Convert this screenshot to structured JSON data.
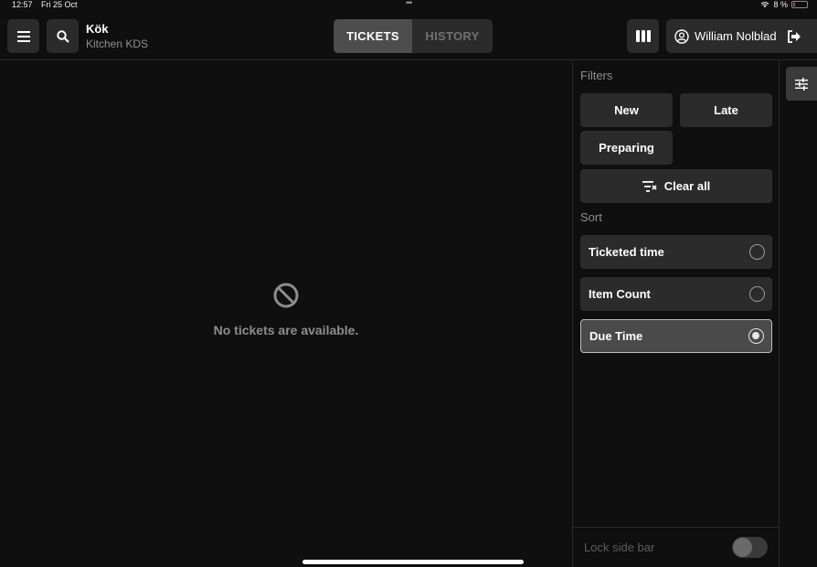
{
  "status": {
    "time": "12:57",
    "date": "Fri 25 Oct",
    "dots": "•••",
    "battery": "8 %"
  },
  "header": {
    "store_name": "Kök",
    "store_sub": "Kitchen KDS",
    "user_name": "William Nolblad"
  },
  "tabs": [
    {
      "label": "TICKETS",
      "active": true
    },
    {
      "label": "HISTORY",
      "active": false
    }
  ],
  "main": {
    "empty_message": "No tickets are available."
  },
  "sidebar": {
    "filters_heading": "Filters",
    "filters": [
      "New",
      "Late",
      "Preparing"
    ],
    "clear_all": "Clear all",
    "sort_heading": "Sort",
    "sort_options": [
      {
        "label": "Ticketed time",
        "selected": false
      },
      {
        "label": "Item Count",
        "selected": false
      },
      {
        "label": "Due Time",
        "selected": true
      }
    ],
    "lock_label": "Lock side bar",
    "lock_on": false
  },
  "colors": {
    "background": "#0f0f0f",
    "button": "#2b2b2b",
    "active": "#4d4d4d",
    "battery_low": "#e33b3b"
  }
}
